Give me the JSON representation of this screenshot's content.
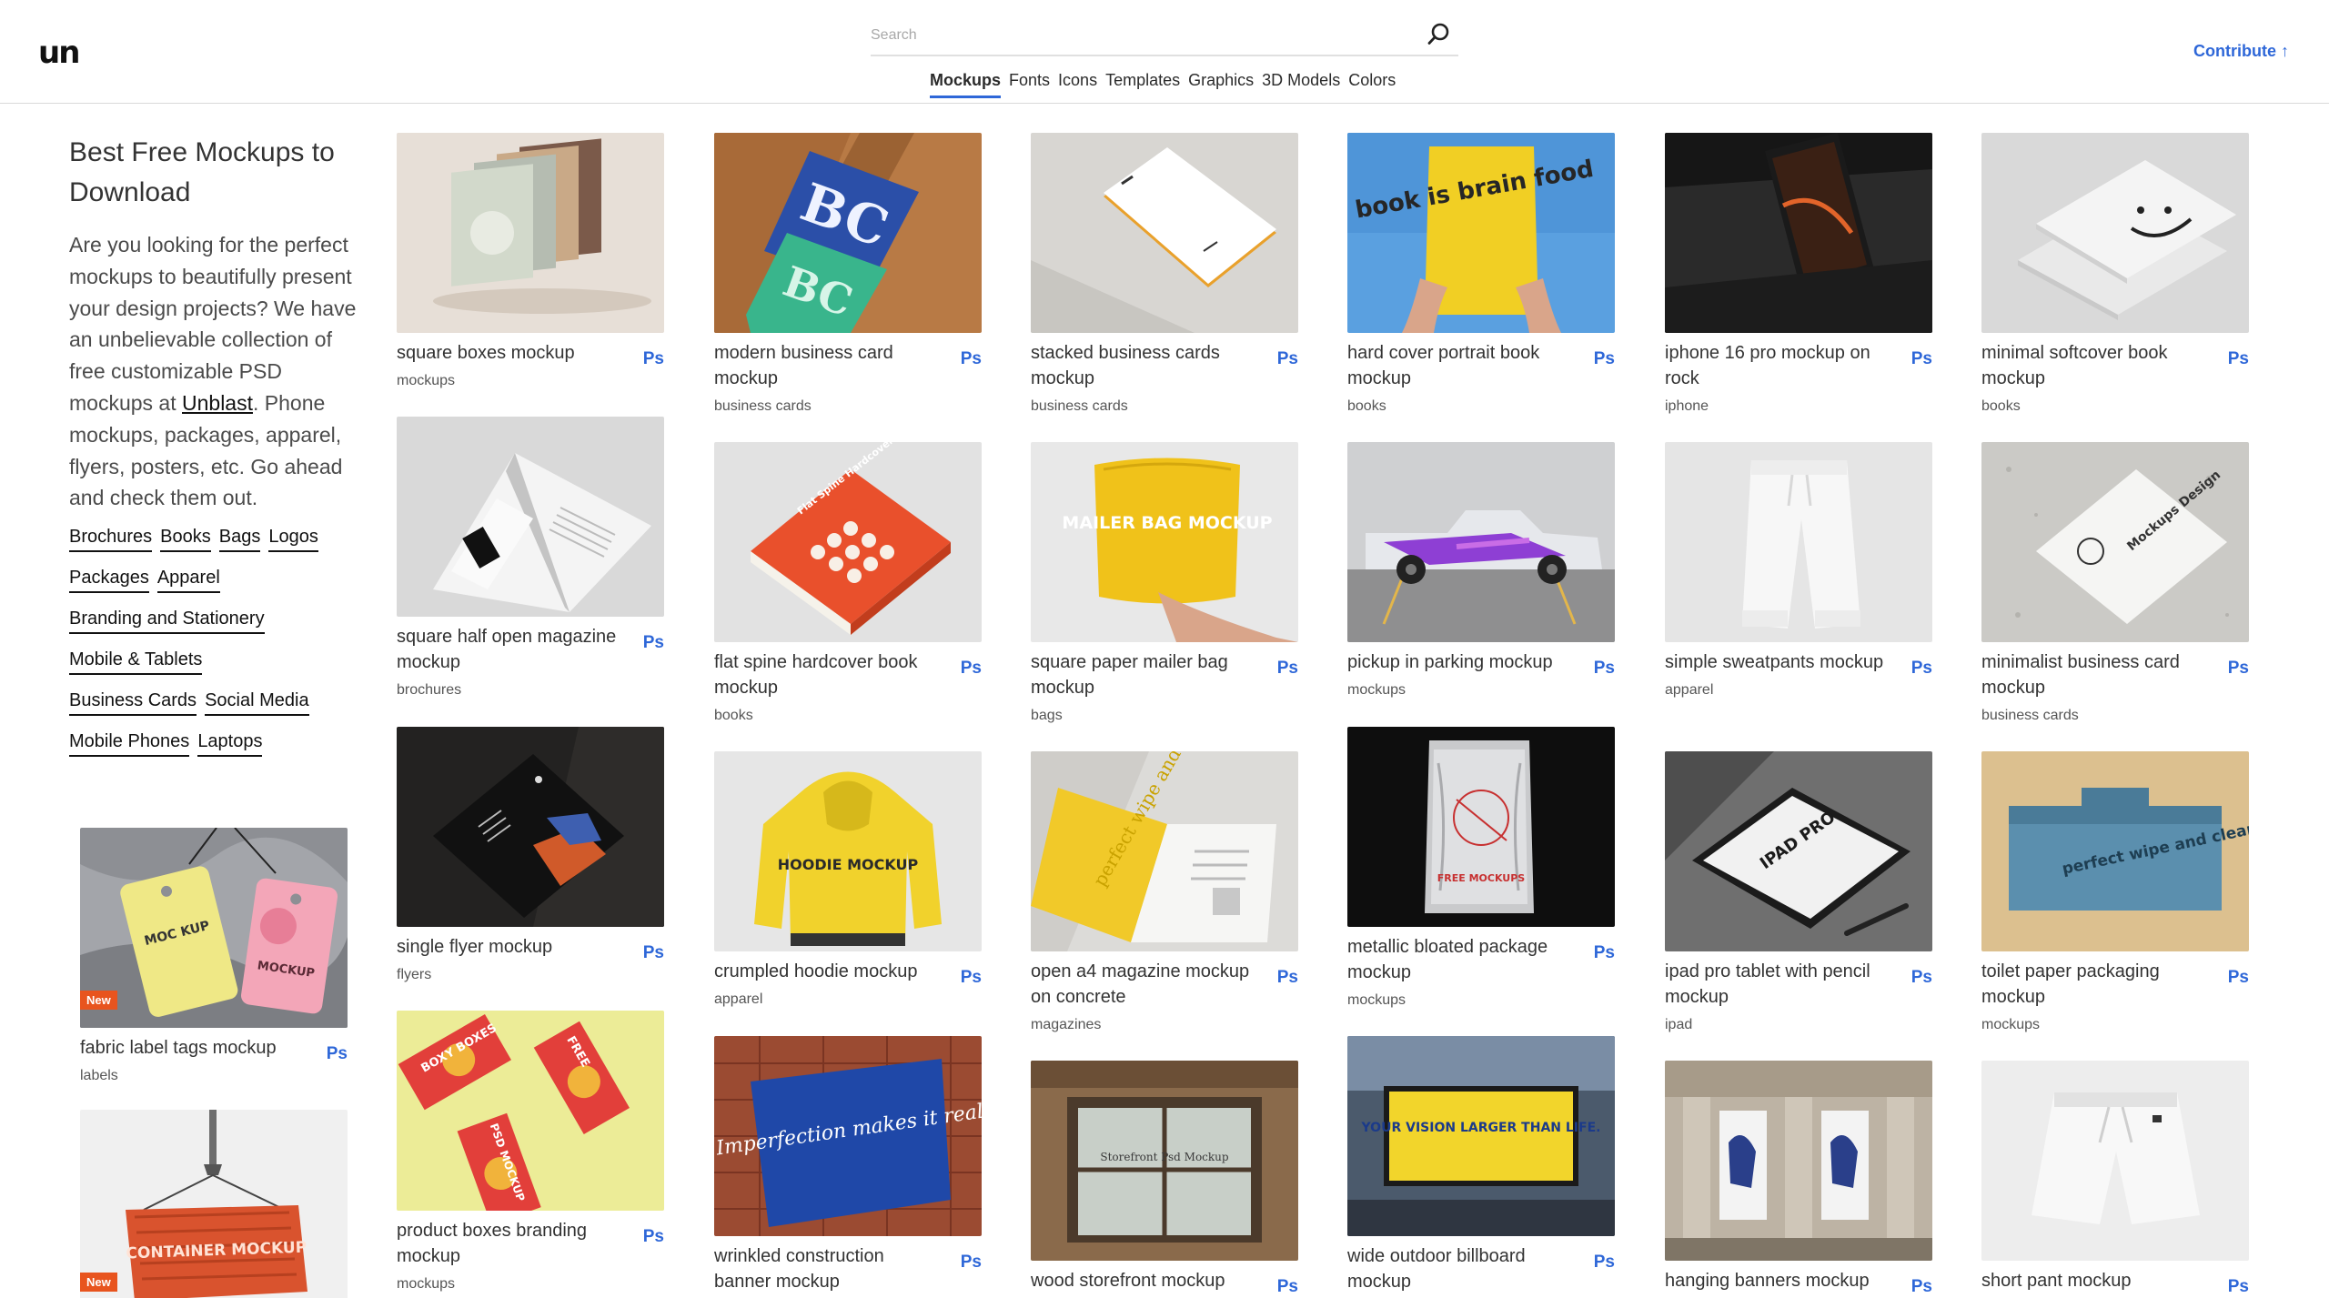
{
  "header": {
    "logo": "un",
    "search_placeholder": "Search",
    "nav": [
      "Mockups",
      "Fonts",
      "Icons",
      "Templates",
      "Graphics",
      "3D Models",
      "Colors"
    ],
    "contribute": "Contribute ↑"
  },
  "sidebar": {
    "heading": "Best Free Mockups to Download",
    "intro_before": "Are you looking for the perfect mockups to beautifully present your design projects? We have an unbelievable collection of free customizable PSD mockups at ",
    "intro_link": "Unblast",
    "intro_after": ". Phone mockups, packages, apparel, flyers, posters, etc. Go ahead and check them out.",
    "tag_rows": [
      [
        "Brochures",
        "Books",
        "Bags",
        "Logos"
      ],
      [
        "Packages",
        "Apparel"
      ],
      [
        "Branding and Stationery"
      ],
      [
        "Mobile & Tablets"
      ],
      [
        "Business Cards",
        "Social Media"
      ],
      [
        "Mobile Phones",
        "Laptops"
      ]
    ]
  },
  "ps_label": "Ps",
  "new_label": "New",
  "cards": [
    {
      "title": "square boxes mockup",
      "category": "mockups"
    },
    {
      "title": "modern business card mockup",
      "category": "business cards"
    },
    {
      "title": "stacked business cards mockup",
      "category": "business cards"
    },
    {
      "title": "hard cover portrait book mockup",
      "category": "books"
    },
    {
      "title": "iphone 16 pro mockup on rock",
      "category": "iphone"
    },
    {
      "title": "minimal softcover book mockup",
      "category": "books"
    },
    {
      "title": "square half open magazine mockup",
      "category": "brochures"
    },
    {
      "title": "flat spine hardcover book mockup",
      "category": "books"
    },
    {
      "title": "square paper mailer bag mockup",
      "category": "bags"
    },
    {
      "title": "pickup in parking mockup",
      "category": "mockups"
    },
    {
      "title": "simple sweatpants mockup",
      "category": "apparel"
    },
    {
      "title": "minimalist business card mockup",
      "category": "business cards"
    },
    {
      "title": "single flyer mockup",
      "category": "flyers"
    },
    {
      "title": "crumpled hoodie mockup",
      "category": "apparel"
    },
    {
      "title": "open a4 magazine mockup on concrete",
      "category": "magazines"
    },
    {
      "title": "metallic bloated package mockup",
      "category": "mockups"
    },
    {
      "title": "ipad pro tablet with pencil mockup",
      "category": "ipad"
    },
    {
      "title": "toilet paper packaging mockup",
      "category": "mockups"
    },
    {
      "title": "product boxes branding mockup",
      "category": "mockups"
    },
    {
      "title": "wrinkled construction banner mockup",
      "category": ""
    },
    {
      "title": "wood storefront mockup",
      "category": ""
    },
    {
      "title": "wide outdoor billboard mockup",
      "category": ""
    },
    {
      "title": "hanging banners mockup",
      "category": ""
    },
    {
      "title": "short pant mockup",
      "category": ""
    },
    {
      "title": "fabric label tags mockup",
      "category": "labels"
    },
    {
      "title": "",
      "category": ""
    }
  ],
  "image_text": {
    "bc": "BC",
    "book_is_brain_food": "book is brain food",
    "flat_spine": "Flat Spine Hardcover Book Mockup",
    "mailer": "MAILER BAG MOCKUP",
    "hoodie": "HOODIE MOCKUP",
    "imperfection": "Imperfection makes it real",
    "storefront": "Storefront Psd Mockup",
    "billboard": "YOUR VISION LARGER THAN LIFE.",
    "ipad": "IPAD PRO",
    "perfect": "perfect wipe and clean",
    "container": "CONTAINER MOCKUP",
    "mockup_tag": "MOCKUP",
    "moc_kup": "MOC KUP",
    "free": "FREE",
    "psd_mockup": "PSD MOCKUP",
    "boxy_boxes": "BOXY BOXES",
    "free_mockups": "FREE MOCKUPS",
    "mockups_design": "Mockups Design"
  }
}
